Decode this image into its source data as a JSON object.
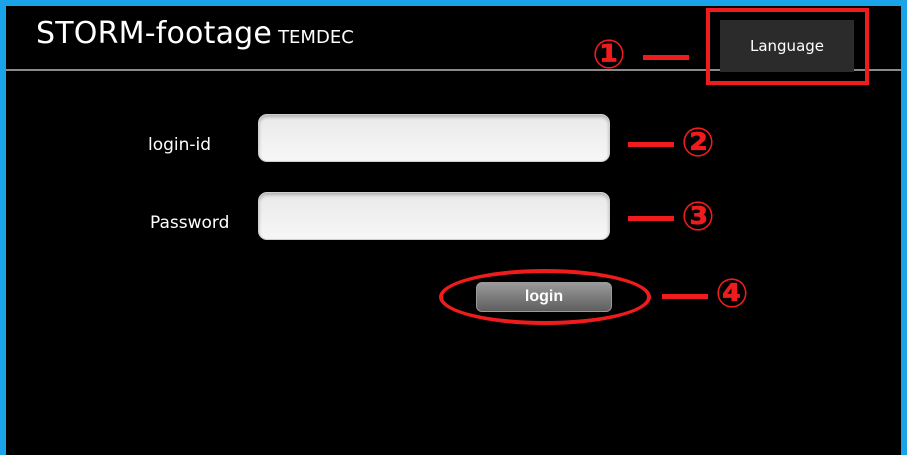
{
  "header": {
    "app_name": "STORM-footage",
    "org_name": "TEMDEC",
    "language_label": "Language"
  },
  "form": {
    "login_id_label": "login-id",
    "login_id_value": "",
    "password_label": "Password",
    "password_value": "",
    "login_label": "login"
  },
  "callouts": {
    "c1": "①",
    "c2": "②",
    "c3": "③",
    "c4": "④"
  },
  "colors": {
    "frame_border": "#1aa3e8",
    "background": "#000000",
    "annotation": "#ee1c1c"
  }
}
